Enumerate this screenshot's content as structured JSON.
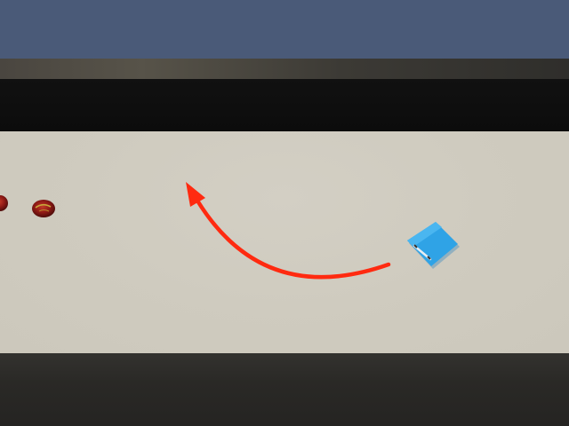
{
  "scene": {
    "sky_color": "#4a5a78",
    "floor_color": "#cfcbbf",
    "accent_arrow_color": "#ff2a10",
    "agent_color": "#2fa3e6",
    "fruit_color": "#8f1a16"
  },
  "objects": {
    "agent": {
      "icon": "blue-cube-agent-icon"
    },
    "fruits": [
      {
        "icon": "red-fruit-icon"
      },
      {
        "icon": "red-fruit-icon"
      }
    ],
    "path_arrow": {
      "icon": "curved-arrow-icon"
    }
  }
}
